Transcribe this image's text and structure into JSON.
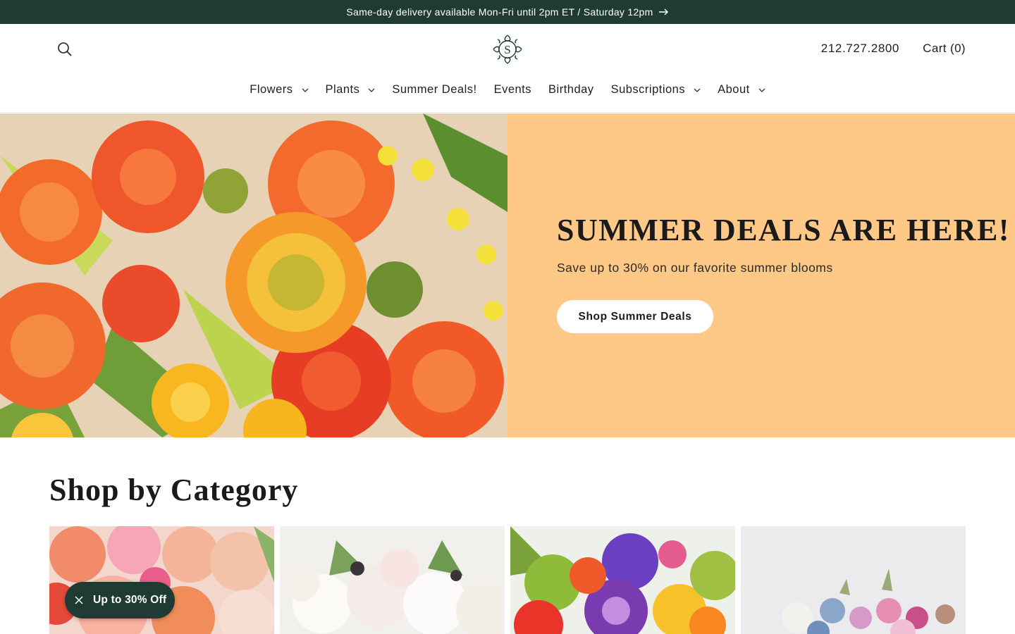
{
  "announcement": {
    "text": "Same-day delivery available Mon-Fri until 2pm ET / Saturday 12pm",
    "icon": "arrow-right-icon"
  },
  "header": {
    "logo_letter": "S",
    "phone": "212.727.2800",
    "cart_label": "Cart (0)",
    "nav": [
      {
        "label": "Flowers",
        "has_dropdown": true
      },
      {
        "label": "Plants",
        "has_dropdown": true
      },
      {
        "label": "Summer Deals!",
        "has_dropdown": false
      },
      {
        "label": "Events",
        "has_dropdown": false
      },
      {
        "label": "Birthday",
        "has_dropdown": false
      },
      {
        "label": "Subscriptions",
        "has_dropdown": true
      },
      {
        "label": "About",
        "has_dropdown": true
      }
    ]
  },
  "hero": {
    "title": "SUMMER DEALS ARE HERE!",
    "subtitle": "Save up to 30% on our favorite summer blooms",
    "button_label": "Shop Summer Deals",
    "panel_color": "#fec886"
  },
  "categories": {
    "title": "Shop by Category",
    "cards": [
      "pastel-roses-bouquet",
      "white-flowers-arrangement",
      "colorful-orchid-bouquet",
      "wildflower-arrangement"
    ]
  },
  "promo": {
    "label": "Up to 30% Off",
    "color": "#1f3b33"
  }
}
